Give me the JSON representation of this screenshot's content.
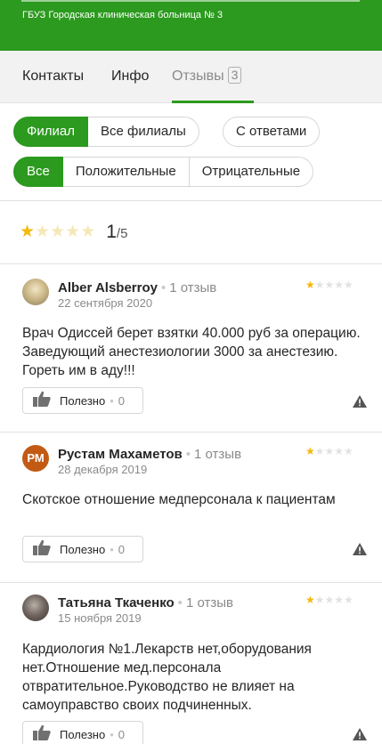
{
  "header": {
    "org_name": "ГБУЗ Городская клиническая больница № 3"
  },
  "tabs": [
    {
      "label": "Контакты"
    },
    {
      "label": "Инфо"
    },
    {
      "label": "Отзывы",
      "count": "3"
    }
  ],
  "filters": {
    "scope": [
      "Филиал",
      "Все филиалы"
    ],
    "with_answers": "С ответами",
    "sentiment": [
      "Все",
      "Положительные",
      "Отрицательные"
    ]
  },
  "summary": {
    "rating": "1",
    "max": "/5",
    "stars": 1
  },
  "colors": {
    "brand_green": "#2b9a1e",
    "star_yellow": "#f3b90d"
  },
  "reviews": [
    {
      "author": "Alber Alsberroy",
      "review_count": "1 отзыв",
      "date": "22 сентября 2020",
      "stars": 1,
      "avatar": "photo",
      "text": "Врач Одиссей берет взятки 40.000 руб за операцию. Заведующий анестезиологии 3000 за анестезию. Гореть им в аду!!!",
      "useful_label": "Полезно",
      "useful_count": "0"
    },
    {
      "author": "Рустам Махаметов",
      "review_count": "1 отзыв",
      "date": "28 декабря 2019",
      "stars": 1,
      "avatar_initials": "РМ",
      "text": "Скотское отношение медперсонала к пациентам",
      "useful_label": "Полезно",
      "useful_count": "0"
    },
    {
      "author": "Татьяна Ткаченко",
      "review_count": "1 отзыв",
      "date": "15 ноября 2019",
      "stars": 1,
      "avatar": "photo",
      "text": "Кардиология №1.Лекарств нет,оборудования нет.Отношение мед.персонала отвратительное.Руководство не влияет на самоуправство своих подчиненных.",
      "useful_label": "Полезно",
      "useful_count": "0"
    }
  ]
}
